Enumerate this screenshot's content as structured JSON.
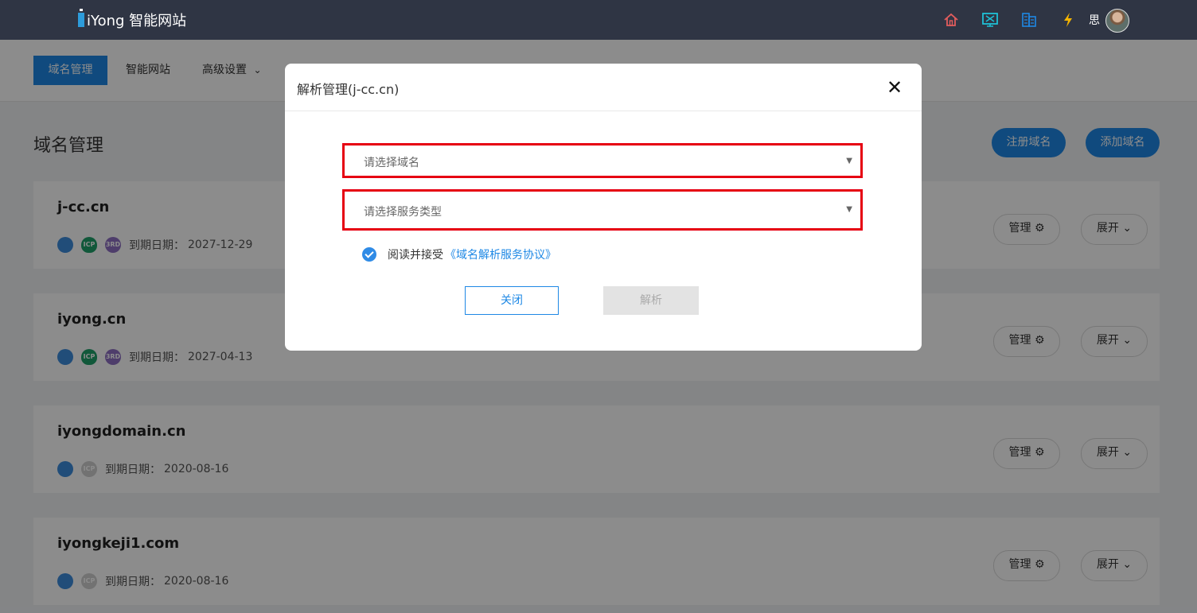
{
  "app": {
    "brand": "iYong 智能网站"
  },
  "header": {
    "icons": [
      "home-icon",
      "monitor-icon",
      "building-icon",
      "lightning-icon"
    ],
    "username": "思",
    "colors": {
      "home": "#e35d5d",
      "monitor": "#1ec1d6",
      "building": "#1e88e5",
      "lightning": "#f5b400"
    }
  },
  "subnav": {
    "items": [
      {
        "label": "域名管理"
      },
      {
        "label": "智能网站"
      },
      {
        "label": "高级设置"
      }
    ]
  },
  "page": {
    "title": "域名管理",
    "register_button": "注册域名",
    "add_button": "添加域名"
  },
  "domains": [
    {
      "name": "j-cc.cn",
      "expiry_label": "到期日期：",
      "expiry": "2027-12-29",
      "badges": [
        "globe",
        "icp",
        "3rd"
      ]
    },
    {
      "name": "iyong.cn",
      "expiry_label": "到期日期：",
      "expiry": "2027-04-13",
      "badges": [
        "globe",
        "icp",
        "3rd"
      ]
    },
    {
      "name": "iyongdomain.cn",
      "expiry_label": "到期日期：",
      "expiry": "2020-08-16",
      "badges": [
        "globe",
        "icp-grey"
      ]
    },
    {
      "name": "iyongkeji1.com",
      "expiry_label": "到期日期：",
      "expiry": "2020-08-16",
      "badges": [
        "globe",
        "icp-grey"
      ]
    }
  ],
  "card_actions": {
    "manage": "管理",
    "expand": "展开"
  },
  "modal": {
    "title": "解析管理(j-cc.cn)",
    "domain_select_placeholder": "请选择域名",
    "service_select_placeholder": "请选择服务类型",
    "agree_text": "阅读并接受",
    "agree_link": "《域名解析服务协议》",
    "close_button": "关闭",
    "submit_button": "解析"
  }
}
